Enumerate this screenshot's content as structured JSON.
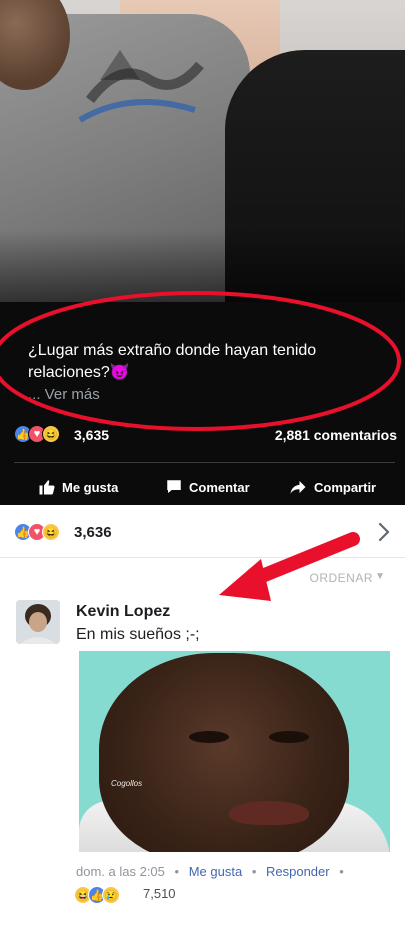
{
  "post": {
    "caption": "¿Lugar más extraño donde hayan tenido relaciones?😈",
    "see_more": "... Ver más",
    "reaction_count": "3,635",
    "comments_count": "2,881 comentarios",
    "actions": {
      "like": "Me gusta",
      "comment": "Comentar",
      "share": "Compartir"
    }
  },
  "reactions_bar": {
    "count": "3,636"
  },
  "sort_label": "ORDENAR",
  "comment": {
    "author": "Kevin Lopez",
    "text": "En mis sueños ;-;",
    "image_watermark": "Cogollos",
    "time": "dom. a las 2:05",
    "like_label": "Me gusta",
    "reply_label": "Responder",
    "separator": "•",
    "reaction_count": "7,510"
  },
  "colors": {
    "annotation_red": "#e8102a",
    "link_blue": "#4267b2",
    "like_blue": "#4a86e8",
    "love_red": "#f25268",
    "haha_yellow": "#f7c94a",
    "meme_bg": "#86dbd0"
  },
  "icons": [
    "like-icon",
    "love-icon",
    "haha-icon",
    "sad-icon",
    "thumbs-up-icon",
    "comment-icon",
    "share-icon",
    "chevron-right-icon",
    "chevron-down-icon"
  ]
}
